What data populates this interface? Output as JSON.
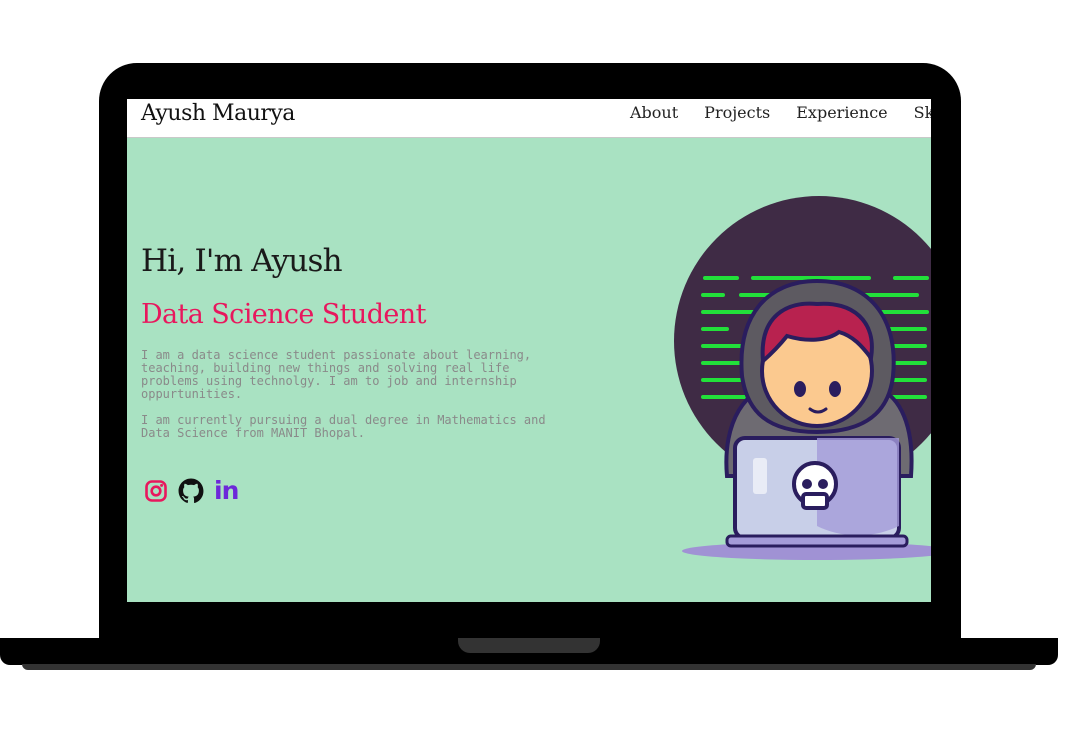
{
  "site": {
    "brand": "Ayush Maurya",
    "nav": [
      "About",
      "Projects",
      "Experience",
      "Skills"
    ]
  },
  "hero": {
    "greeting": "Hi, I'm Ayush",
    "role": "Data Science Student",
    "bio": [
      "I am a data science student passionate about learning, teaching, building new things and solving real life problems using technolgy. I am to job and internship oppurtunities.",
      "I am currently pursuing a dual degree in Mathematics and Data Science from MANIT Bhopal."
    ],
    "socials": [
      {
        "name": "instagram",
        "icon": "instagram-icon",
        "color": "#e8175d"
      },
      {
        "name": "github",
        "icon": "github-icon",
        "color": "#111111"
      },
      {
        "name": "linkedin",
        "icon": "linkedin-icon",
        "label": "in",
        "color": "#6d28d9"
      }
    ]
  },
  "colors": {
    "background": "#a9e2c2",
    "accent": "#e8175d",
    "text": "#1a1a1a",
    "muted": "#8a8a8a",
    "illustration_circle": "#3f2b45",
    "code_lines": "#22e03a"
  }
}
